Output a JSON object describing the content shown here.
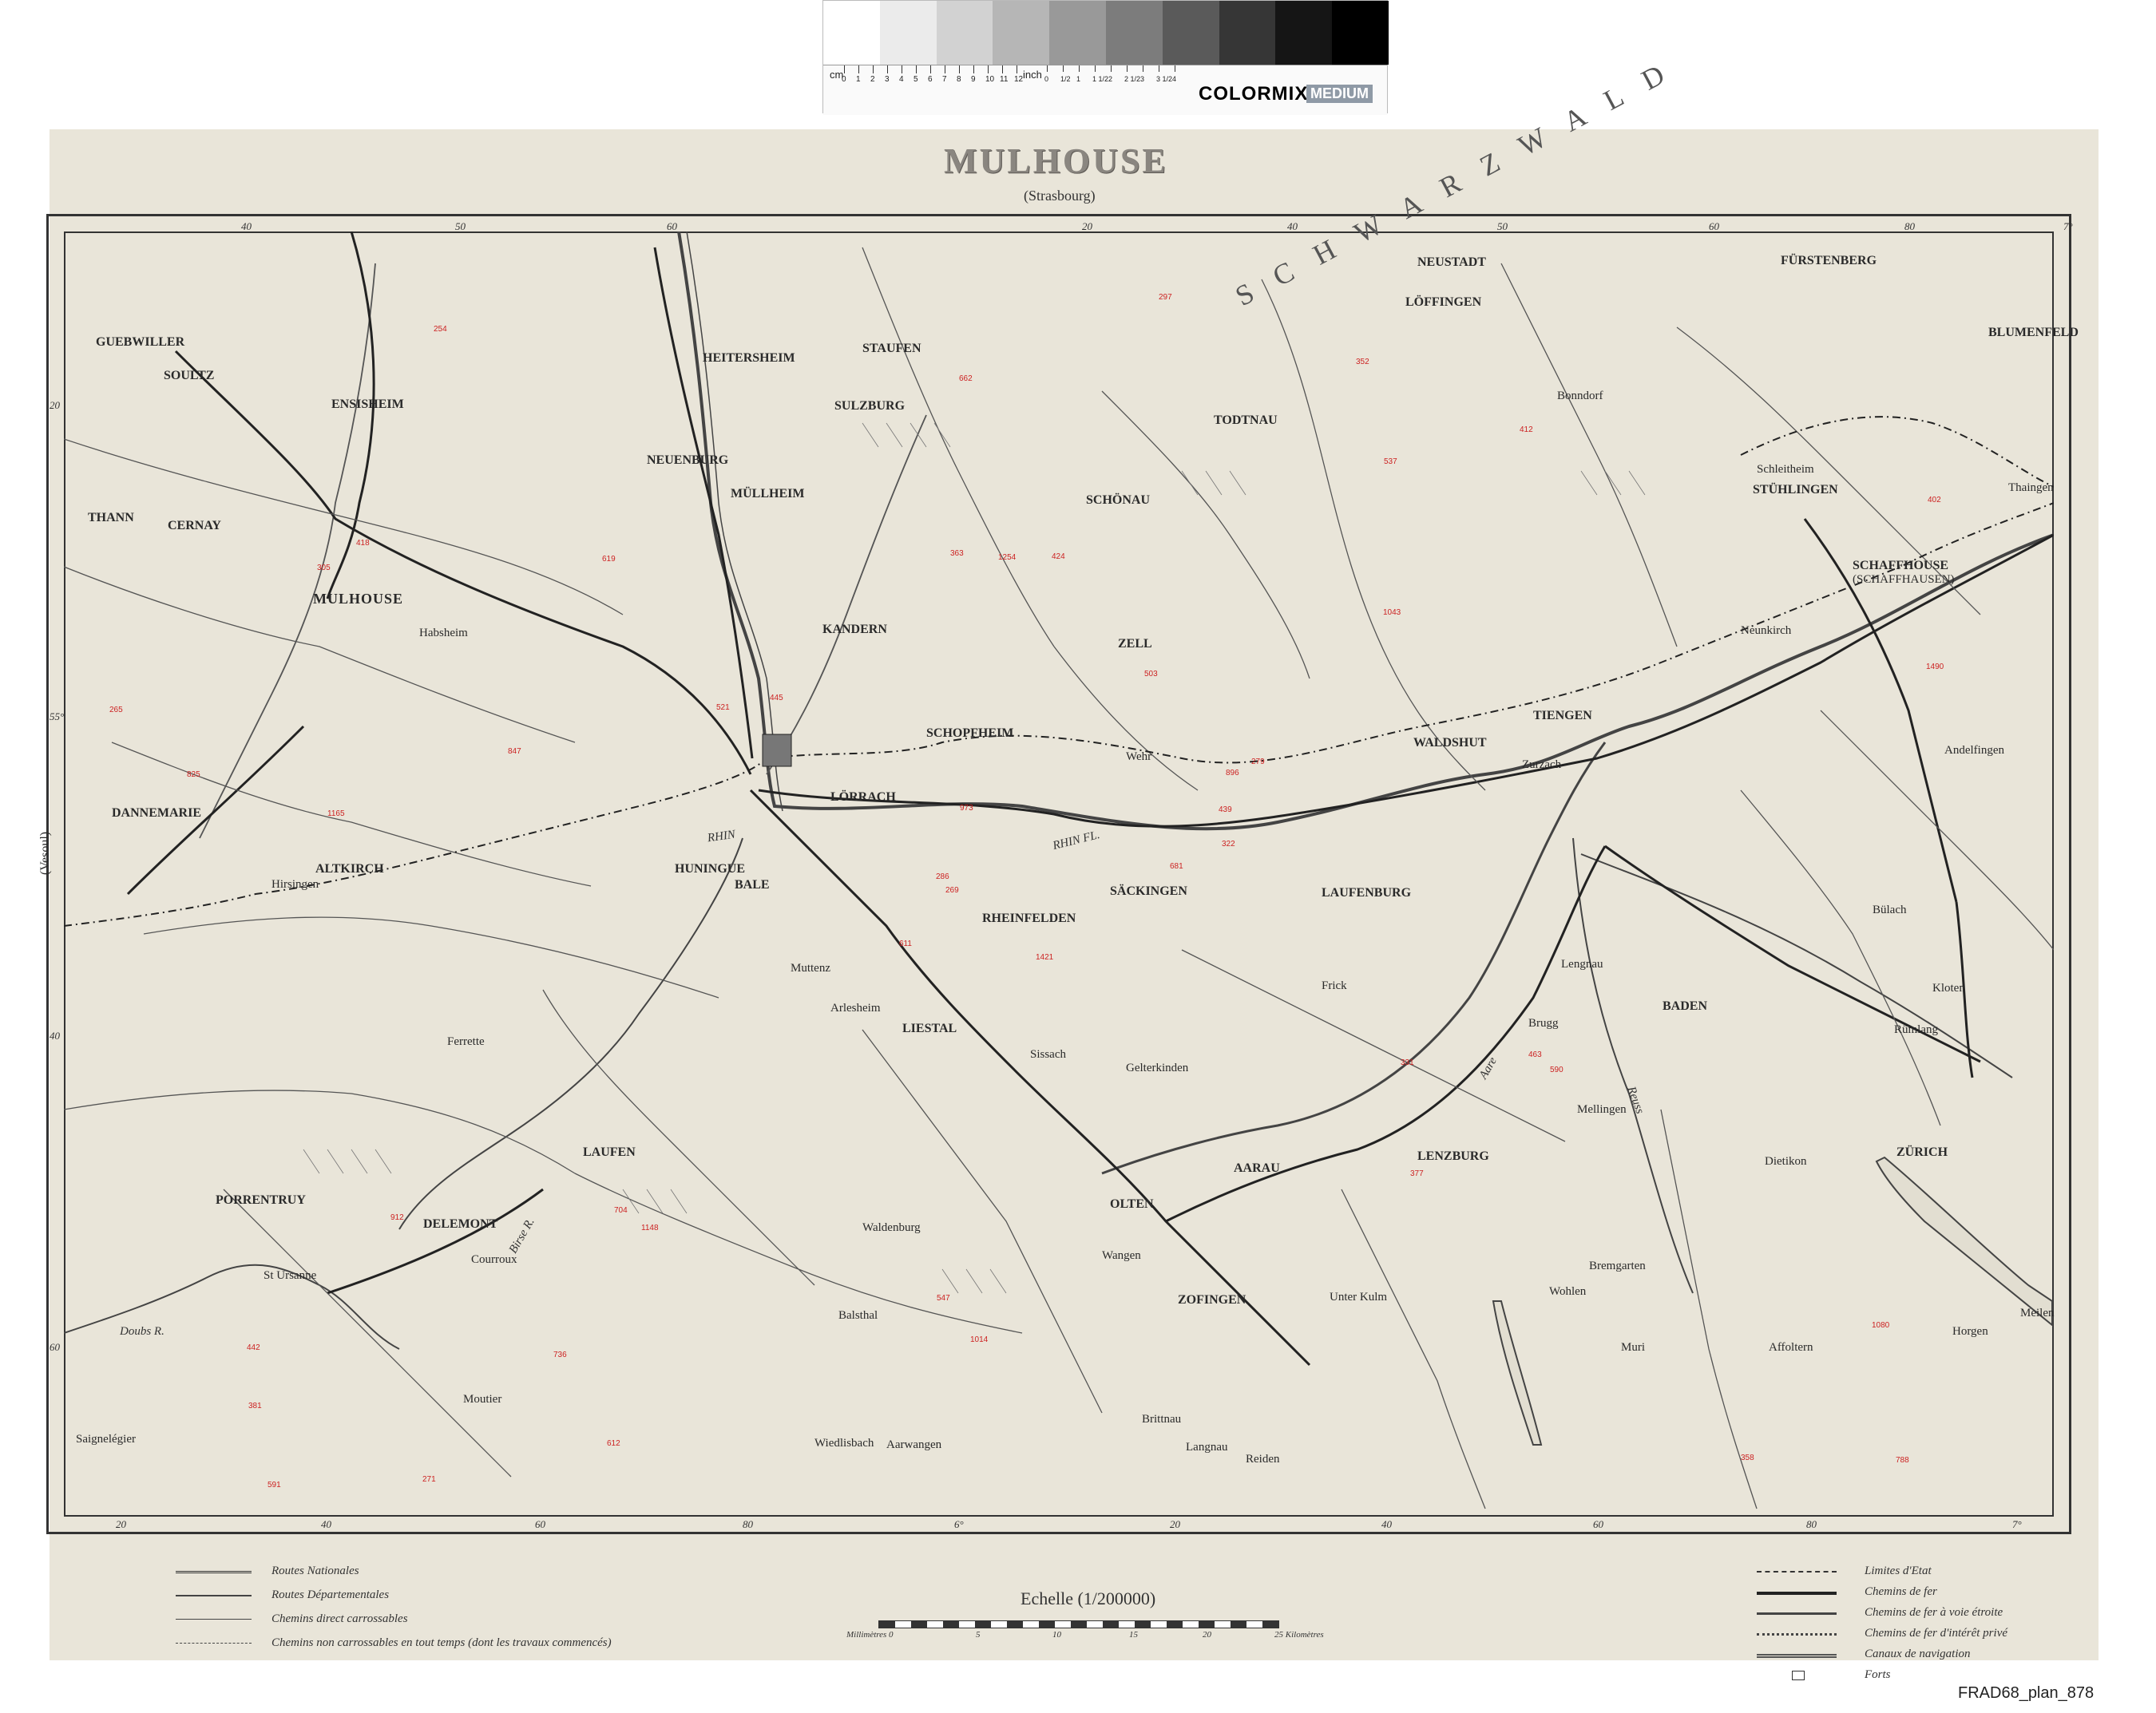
{
  "colorbar": {
    "swatches": [
      "#ffffff",
      "#ebebeb",
      "#d2d2d2",
      "#b6b6b6",
      "#999999",
      "#7c7c7c",
      "#5a5a5a",
      "#363636",
      "#151515",
      "#000000"
    ],
    "brand": "COLORMIX",
    "badge": "MEDIUM",
    "cm_label": "cm",
    "cm_ticks": [
      "0",
      "1",
      "2",
      "3",
      "4",
      "5",
      "6",
      "7",
      "8",
      "9",
      "10",
      "11",
      "12"
    ],
    "inch_label": "inch",
    "inch_ticks": [
      "0",
      "1/2",
      "1",
      "1 1/2",
      "2",
      "2 1/2",
      "3",
      "3 1/2",
      "4"
    ]
  },
  "map": {
    "title": "MULHOUSE",
    "subtitle": "(Strasbourg)",
    "side_label": "(Vesoul)",
    "region_label": "S C H W A R Z W A L D",
    "top_edge": [
      "40",
      "50",
      "60",
      "20",
      "40",
      "50",
      "60",
      "80",
      "7°"
    ],
    "bottom_edge": [
      "20",
      "40",
      "60",
      "80",
      "6°",
      "20",
      "40",
      "60",
      "80",
      "7°"
    ],
    "left_edge": [
      "20",
      "55°",
      "40",
      "60"
    ],
    "cities": [
      {
        "id": "mulhouse",
        "name": "MULHOUSE"
      },
      {
        "id": "guebwiller",
        "name": "GUEBWILLER"
      },
      {
        "id": "thann",
        "name": "THANN"
      },
      {
        "id": "ensisheim",
        "name": "ENSISHEIM"
      },
      {
        "id": "neuenburg",
        "name": "NEUENBURG"
      },
      {
        "id": "mullheim",
        "name": "MÜLLHEIM"
      },
      {
        "id": "staufen",
        "name": "STAUFEN"
      },
      {
        "id": "heitersheim",
        "name": "HEITERSHEIM"
      },
      {
        "id": "sulzburg",
        "name": "SULZBURG"
      },
      {
        "id": "kandern",
        "name": "KANDERN"
      },
      {
        "id": "schopfheim",
        "name": "SCHOPFHEIM"
      },
      {
        "id": "lorrach",
        "name": "LÖRRACH"
      },
      {
        "id": "huningue",
        "name": "HUNINGUE"
      },
      {
        "id": "altkirch",
        "name": "ALTKIRCH"
      },
      {
        "id": "dannemarie",
        "name": "DANNEMARIE"
      },
      {
        "id": "ferrette",
        "name": "Ferrette"
      },
      {
        "id": "arlesheim",
        "name": "Arlesheim"
      },
      {
        "id": "liestal",
        "name": "LIESTAL"
      },
      {
        "id": "delemont",
        "name": "DELEMONT"
      },
      {
        "id": "porrentruy",
        "name": "PORRENTRUY"
      },
      {
        "id": "laufen",
        "name": "LAUFEN"
      },
      {
        "id": "waldenburg",
        "name": "Waldenburg"
      },
      {
        "id": "balsthal",
        "name": "Balsthal"
      },
      {
        "id": "moutier",
        "name": "Moutier"
      },
      {
        "id": "saignelegier",
        "name": "Saignelégier"
      },
      {
        "id": "rheinfelden",
        "name": "RHEINFELDEN"
      },
      {
        "id": "sackingen",
        "name": "SÄCKINGEN"
      },
      {
        "id": "laufenburg",
        "name": "LAUFENBURG"
      },
      {
        "id": "waldshut",
        "name": "WALDSHUT"
      },
      {
        "id": "tiengen",
        "name": "TIENGEN"
      },
      {
        "id": "zurzach",
        "name": "Zurzach"
      },
      {
        "id": "brugg",
        "name": "Brugg"
      },
      {
        "id": "baden",
        "name": "BADEN"
      },
      {
        "id": "aarau",
        "name": "AARAU"
      },
      {
        "id": "olten",
        "name": "OLTEN"
      },
      {
        "id": "zofingen",
        "name": "ZOFINGEN"
      },
      {
        "id": "lenzburg",
        "name": "LENZBURG"
      },
      {
        "id": "zurich",
        "name": "ZÜRICH"
      },
      {
        "id": "schaffhouse",
        "name": "SCHAFFHOUSE"
      },
      {
        "id": "schaffhausen",
        "name": "(SCHAFFHAUSEN)"
      },
      {
        "id": "stuhlingen",
        "name": "STÜHLINGEN"
      },
      {
        "id": "bonndorf",
        "name": "Bonndorf"
      },
      {
        "id": "neustadt",
        "name": "NEUSTADT"
      },
      {
        "id": "lofingen",
        "name": "LÖFFINGEN"
      },
      {
        "id": "furstenberg",
        "name": "FÜRSTENBERG"
      },
      {
        "id": "blumenfeld",
        "name": "BLUMENFELD"
      },
      {
        "id": "thaingen",
        "name": "Thaingen"
      },
      {
        "id": "schleitheim",
        "name": "Schleitheim"
      },
      {
        "id": "andelfingen",
        "name": "Andelfingen"
      },
      {
        "id": "bulach",
        "name": "Bülach"
      },
      {
        "id": "kloten",
        "name": "Kloten"
      },
      {
        "id": "meilen",
        "name": "Meilen"
      },
      {
        "id": "horgen",
        "name": "Horgen"
      },
      {
        "id": "affoltern",
        "name": "Affoltern"
      },
      {
        "id": "muri",
        "name": "Muri"
      },
      {
        "id": "bremgarten",
        "name": "Bremgarten"
      },
      {
        "id": "wohlen",
        "name": "Wohlen"
      },
      {
        "id": "reiden",
        "name": "Reiden"
      },
      {
        "id": "unterkulm",
        "name": "Unter Kulm"
      },
      {
        "id": "schonau",
        "name": "SCHÖNAU"
      },
      {
        "id": "todtnau",
        "name": "TODTNAU"
      },
      {
        "id": "wehr",
        "name": "Wehr"
      },
      {
        "id": "habsheim",
        "name": "Habsheim"
      },
      {
        "id": "hirsingen",
        "name": "Hirsingen"
      },
      {
        "id": "zell",
        "name": "ZELL"
      },
      {
        "id": "wiedlisbach",
        "name": "Wiedlisbach"
      },
      {
        "id": "wangen",
        "name": "Wangen"
      },
      {
        "id": "aarwangen",
        "name": "Aarwangen"
      },
      {
        "id": "soultz",
        "name": "SOULTZ"
      },
      {
        "id": "cernay",
        "name": "CERNAY"
      },
      {
        "id": "lenggau",
        "name": "Lengnau"
      },
      {
        "id": "neunkirch",
        "name": "Neunkirch"
      },
      {
        "id": "muttenz",
        "name": "Muttenz"
      },
      {
        "id": "sissach",
        "name": "Sissach"
      },
      {
        "id": "gelterkinden",
        "name": "Gelterkinden"
      },
      {
        "id": "frick",
        "name": "Frick"
      },
      {
        "id": "rumlang",
        "name": "Rümlang"
      },
      {
        "id": "dietikon",
        "name": "Dietikon"
      },
      {
        "id": "mellingen",
        "name": "Mellingen"
      },
      {
        "id": "brittnau",
        "name": "Brittnau"
      },
      {
        "id": "langnau",
        "name": "Langnau"
      },
      {
        "id": "st_ursanne",
        "name": "St Ursanne"
      },
      {
        "id": "courroux",
        "name": "Courroux"
      },
      {
        "id": "basel",
        "name": "BALE"
      }
    ],
    "rivers": [
      "RHIN",
      "RHIN FL.",
      "Birse R.",
      "Doubs R.",
      "Aare",
      "Reuss"
    ],
    "altitudes": [
      "1421",
      "305",
      "269",
      "442",
      "896",
      "1148",
      "352",
      "424",
      "537",
      "681",
      "254",
      "788",
      "1165",
      "402",
      "611",
      "1043",
      "271",
      "363",
      "503",
      "912",
      "445",
      "381",
      "736",
      "1254",
      "279",
      "590",
      "418",
      "662",
      "825",
      "331",
      "1490",
      "286",
      "547",
      "973",
      "619",
      "412",
      "704",
      "358",
      "1080",
      "463",
      "297",
      "521",
      "847",
      "377",
      "612",
      "265",
      "439",
      "591",
      "1014",
      "322"
    ]
  },
  "legend": {
    "left": [
      {
        "label": "Routes Nationales"
      },
      {
        "label": "Routes Départementales"
      },
      {
        "label": "Chemins direct carrossables"
      },
      {
        "label": "Chemins non carrossables en tout temps (dont les travaux commencés)"
      }
    ],
    "right": [
      {
        "label": "Limites d'Etat"
      },
      {
        "label": "Chemins de fer"
      },
      {
        "label": "Chemins de fer à voie étroite"
      },
      {
        "label": "Chemins de fer d'intérêt privé"
      },
      {
        "label": "Canaux de navigation"
      },
      {
        "label": "Forts"
      }
    ],
    "scale_title": "Echelle (1/200000)",
    "scale_labels": [
      "Millimètres 0",
      "5",
      "10",
      "15",
      "20",
      "25 Kilomètres"
    ]
  },
  "catalog": "FRAD68_plan_878"
}
